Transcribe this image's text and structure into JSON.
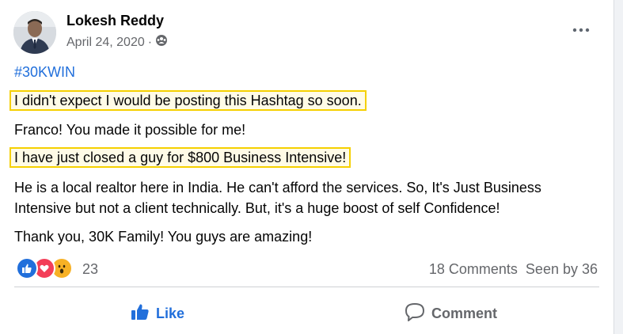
{
  "post": {
    "author": "Lokesh Reddy",
    "date": "April 24, 2020",
    "separator": "·",
    "privacy_icon": "group-icon",
    "more_icon": "more-horizontal-icon",
    "lines": {
      "hashtag": "#30KWIN",
      "line1": "I didn't expect I would be posting this Hashtag so soon.",
      "line2": "Franco! You made it possible for me!",
      "line3": "I have just closed a guy for $800 Business Intensive!",
      "line4": "He is a local realtor here in India. He can't afford the services. So, It's Just Business",
      "line5": "Intensive but not a client technically. But, it's a huge boost of self Confidence!",
      "line6": "Thank you, 30K Family! You guys are amazing!"
    },
    "reactions": {
      "icons": [
        "like-reaction-icon",
        "love-reaction-icon",
        "wow-reaction-icon"
      ],
      "count": "23"
    },
    "stats": {
      "comments": "18 Comments",
      "seen": "Seen by 36"
    },
    "actions": {
      "like_label": "Like",
      "comment_label": "Comment"
    },
    "colors": {
      "like_blue": "#216fdb",
      "love_red": "#f33e58",
      "wow_yellow": "#f7b125",
      "highlight_border": "#f5d000"
    }
  }
}
